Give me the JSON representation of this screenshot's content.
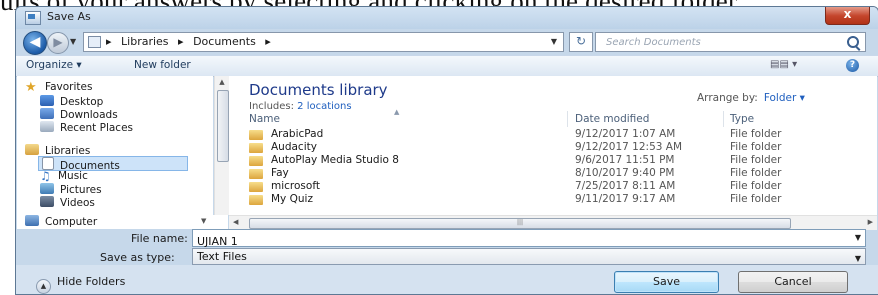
{
  "background_text": "ults of your answers by selecting and clicking on the desired folder.",
  "window": {
    "title": "Save As",
    "close_label": "x"
  },
  "address": {
    "crumbs": [
      "Libraries",
      "Documents"
    ],
    "separator": "▸"
  },
  "search": {
    "placeholder": "Search Documents"
  },
  "toolbar": {
    "organize": "Organize ▾",
    "new_folder": "New folder",
    "views": "▤▤ ▾"
  },
  "nav": {
    "favorites": "Favorites",
    "desktop": "Desktop",
    "downloads": "Downloads",
    "recent": "Recent Places",
    "libraries": "Libraries",
    "documents": "Documents",
    "music": "Music",
    "pictures": "Pictures",
    "videos": "Videos",
    "computer": "Computer"
  },
  "library": {
    "title": "Documents library",
    "includes_label": "Includes:",
    "includes_link": "2 locations",
    "arrange_label": "Arrange by:",
    "arrange_value": "Folder ▾"
  },
  "columns": {
    "name": "Name",
    "date": "Date modified",
    "type": "Type"
  },
  "files": [
    {
      "name": "ArabicPad",
      "date": "9/12/2017 1:07 AM",
      "type": "File folder"
    },
    {
      "name": "Audacity",
      "date": "9/12/2017 12:53 AM",
      "type": "File folder"
    },
    {
      "name": "AutoPlay Media Studio 8",
      "date": "9/6/2017 11:51 PM",
      "type": "File folder"
    },
    {
      "name": "Fay",
      "date": "8/10/2017 9:40 PM",
      "type": "File folder"
    },
    {
      "name": "microsoft",
      "date": "7/25/2017 8:11 AM",
      "type": "File folder"
    },
    {
      "name": "My Quiz",
      "date": "9/11/2017 9:17 AM",
      "type": "File folder"
    }
  ],
  "form": {
    "file_name_label": "File name:",
    "file_name_value": "UJIAN 1",
    "save_type_label": "Save as type:",
    "save_type_value": "Text Files"
  },
  "footer": {
    "hide_folders": "Hide Folders",
    "save": "Save",
    "cancel": "Cancel"
  },
  "colors": {
    "window_frame": "#c6d8ea",
    "accent_link": "#1f5fbf",
    "library_title": "#1e3a8a",
    "close_button": "#c4452c"
  }
}
